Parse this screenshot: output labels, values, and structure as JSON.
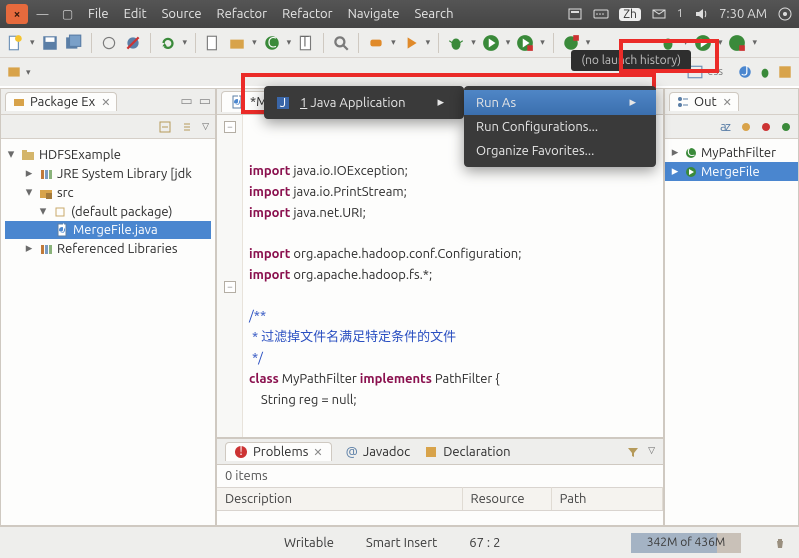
{
  "titlebar": {
    "menu": [
      "File",
      "Edit",
      "Source",
      "Refactor",
      "Refactor",
      "Navigate",
      "Search"
    ],
    "ime_badge": "Zh",
    "tray_count": "1",
    "time": "7:30 AM"
  },
  "toolbar": {
    "tooltip": "(no launch history)"
  },
  "package_explorer": {
    "title": "Package Ex",
    "project": "HDFSExample",
    "jre": "JRE System Library [jdk",
    "src": "src",
    "default_pkg": "(default package)",
    "file": "MergeFile.java",
    "ref_libs": "Referenced Libraries"
  },
  "editor": {
    "tab": "*MergeFile.java",
    "lines": {
      "l1a": "import",
      "l1b": " java.io.IOException;",
      "l2a": "import",
      "l2b": " java.io.PrintStream;",
      "l3a": "import",
      "l3b": " java.net.URI;",
      "l4": "",
      "l5a": "import",
      "l5b": " org.apache.hadoop.conf.Configuration;",
      "l6a": "import",
      "l6b": " org.apache.hadoop.fs.*;",
      "l7": "",
      "l8": "/**",
      "l9": " * 过滤掉文件名满足特定条件的文件",
      "l10": " */",
      "l11a": "class",
      "l11b": " MyPathFilter ",
      "l11c": "implements",
      "l11d": " PathFilter {",
      "l12": "    String reg = null;"
    }
  },
  "context_menu": {
    "item1": "1 Java Application",
    "run_as": "Run As",
    "run_conf": "Run Configurations...",
    "org_fav": "Organize Favorites..."
  },
  "outline": {
    "title": "Out",
    "item1": "MyPathFilter",
    "item2": "MergeFile"
  },
  "problems": {
    "tab1": "Problems",
    "tab2": "Javadoc",
    "tab3": "Declaration",
    "count": "0 items",
    "col1": "Description",
    "col2": "Resource",
    "col3": "Path"
  },
  "status": {
    "writable": "Writable",
    "insert": "Smart Insert",
    "cursor": "67 : 2",
    "heap": "342M of 436M"
  }
}
